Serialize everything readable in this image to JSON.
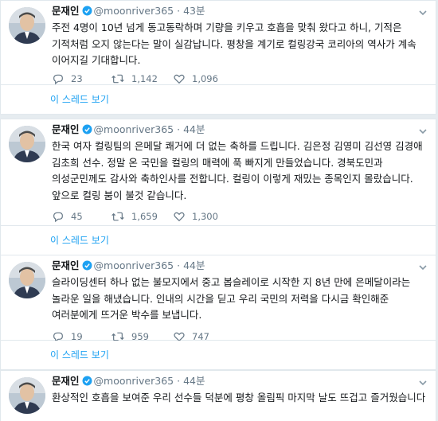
{
  "tweets": [
    {
      "name": "문재인",
      "handle": "@moonriver365",
      "time": "43분",
      "text": "주전 4명이 10년 넘게 동고동락하며 기량을 키우고 호흡을 맞춰 왔다고 하니, 기적은 기적처럼 오지 않는다는 말이 실감납니다. 평창을 계기로 컬링강국 코리아의 역사가 계속 이어지길 기대합니다.",
      "replies": "23",
      "retweets": "1,142",
      "likes": "1,096",
      "thread_link": "이 스레드 보기"
    },
    {
      "name": "문재인",
      "handle": "@moonriver365",
      "time": "44분",
      "text": "한국 여자 컬링팀의 은메달 쾌거에 더 없는 축하를 드립니다. 김은정 김영미 김선영 김경애 김초희 선수. 정말 온 국민을 컬링의 매력에 푹 빠지게 만들었습니다. 경북도민과 의성군민께도 감사와 축하인사를 전합니다. 컬링이 이렇게 재밌는 종목인지 몰랐습니다. 앞으로 컬링 붐이 불것 같습니다.",
      "replies": "45",
      "retweets": "1,659",
      "likes": "1,300",
      "thread_link": "이 스레드 보기"
    },
    {
      "name": "문재인",
      "handle": "@moonriver365",
      "time": "44분",
      "text": "슬라이딩센터 하나 없는 불모지에서 중고 봅슬레이로 시작한 지 8년 만에 은메달이라는 놀라운 일을 해냈습니다. 인내의 시간을 딛고 우리 국민의 저력을 다시금 확인해준 여러분에게 뜨거운 박수를 보냅니다.",
      "replies": "19",
      "retweets": "959",
      "likes": "747",
      "thread_link": "이 스레드 보기"
    },
    {
      "name": "문재인",
      "handle": "@moonriver365",
      "time": "44분",
      "text": "환상적인 호흡을 보여준 우리 선수들 덕분에 평창 올림픽 마지막 날도 뜨겁고 즐거웠습니다"
    }
  ],
  "colors": {
    "link": "#1da1f2",
    "secondary_text": "#657786",
    "background": "#e6ecf0",
    "verified": "#1da1f2"
  },
  "icons": [
    "reply-icon",
    "retweet-icon",
    "like-icon",
    "verified-badge-icon",
    "chevron-down-icon"
  ]
}
